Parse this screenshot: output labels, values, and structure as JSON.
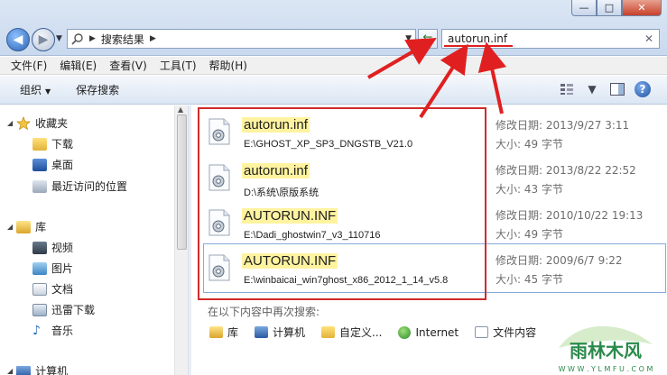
{
  "window": {
    "minimize": "—",
    "maximize": "□",
    "close": "✕"
  },
  "address": {
    "breadcrumb": "搜索结果"
  },
  "search": {
    "value": "autorun.inf",
    "clear": "✕"
  },
  "menu": [
    "文件(F)",
    "编辑(E)",
    "查看(V)",
    "工具(T)",
    "帮助(H)"
  ],
  "commands": {
    "organize": "组织",
    "save_search": "保存搜索"
  },
  "sidebar": {
    "favorites": "收藏夹",
    "fav_items": [
      "下载",
      "桌面",
      "最近访问的位置"
    ],
    "libraries": "库",
    "lib_items": [
      "视频",
      "图片",
      "文档",
      "迅雷下载",
      "音乐"
    ],
    "computer": "计算机"
  },
  "results": [
    {
      "name": "autorun.inf",
      "path": "E:\\GHOST_XP_SP3_DNGSTB_V21.0",
      "date_label": "修改日期:",
      "date": "2013/9/27 3:11",
      "size_label": "大小:",
      "size": "49 字节"
    },
    {
      "name": "autorun.inf",
      "path": "D:\\系统\\原版系统",
      "date_label": "修改日期:",
      "date": "2013/8/22 22:52",
      "size_label": "大小:",
      "size": "43 字节"
    },
    {
      "name": "AUTORUN.INF",
      "path": "E:\\Dadi_ghostwin7_v3_110716",
      "date_label": "修改日期:",
      "date": "2010/10/22 19:13",
      "size_label": "大小:",
      "size": "49 字节"
    },
    {
      "name": "AUTORUN.INF",
      "path": "E:\\winbaicai_win7ghost_x86_2012_1_14_v5.8",
      "date_label": "修改日期:",
      "date": "2009/6/7 9:22",
      "size_label": "大小:",
      "size": "45 字节"
    }
  ],
  "search_again": {
    "label": "在以下内容中再次搜索:",
    "items": [
      "库",
      "计算机",
      "自定义...",
      "Internet",
      "文件内容"
    ]
  },
  "watermark": {
    "text": "雨林木风",
    "url": "W W W . Y L M F U . C O M"
  },
  "colors": {
    "highlight": "#fff3a0",
    "annotation_red": "#d12a2a"
  }
}
